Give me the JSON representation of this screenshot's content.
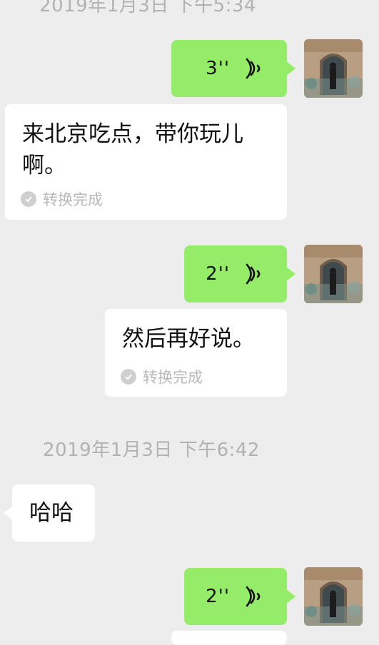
{
  "timestamps": [
    "2019年1月3日 下午5:34",
    "2019年1月3日 下午6:42"
  ],
  "voice_messages": [
    {
      "duration": "3''"
    },
    {
      "duration": "2''"
    },
    {
      "duration": "2''"
    }
  ],
  "transcriptions": [
    {
      "line1": "来北京吃点，带你玩儿",
      "line2": "啊。",
      "status": "转换完成"
    },
    {
      "line1": "然后再好说。",
      "status": "转换完成"
    }
  ],
  "incoming": {
    "text": "哈哈"
  },
  "colors": {
    "background": "#ededed",
    "outgoing_bubble": "#95ec69",
    "incoming_bubble": "#ffffff",
    "timestamp": "#b2b2b2"
  },
  "icons": [
    "voice-wave-icon",
    "check-circle-icon",
    "avatar"
  ]
}
